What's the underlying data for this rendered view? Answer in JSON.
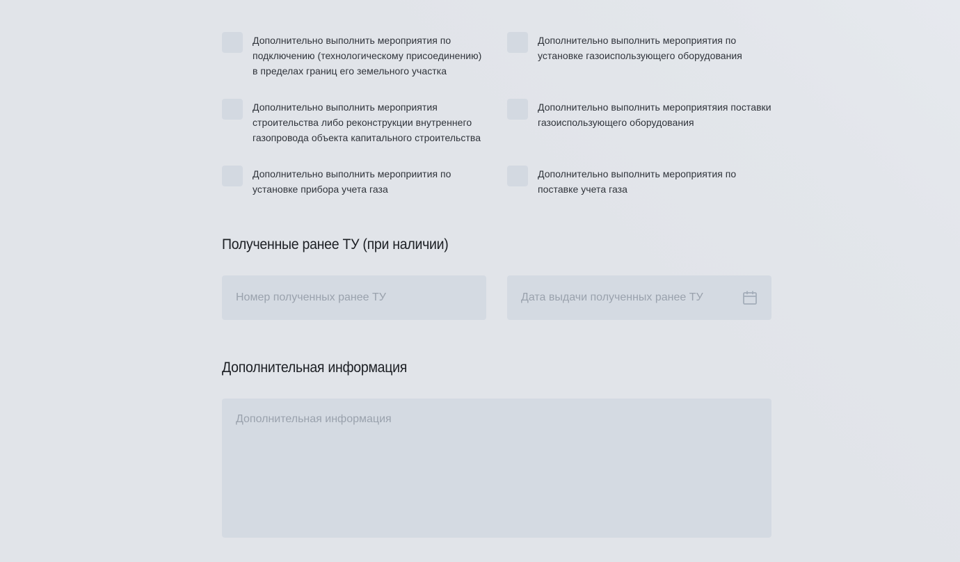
{
  "options": [
    {
      "label": "Дополнительно выполнить мероприятия по подключению (технологическому присоединению) в пределах границ его земельного участка",
      "checked": false
    },
    {
      "label": "Дополнительно выполнить мероприятия по установке газоиспользующего оборудования",
      "checked": false
    },
    {
      "label": "Дополнительно выполнить мероприятия строительства либо реконструкции внутреннего газопровода объекта капитального строительства",
      "checked": false
    },
    {
      "label": "Дополнительно выполнить мероприятяия поставки газоиспользующего оборудования",
      "checked": false
    },
    {
      "label": "Дополнительно выполнить мероприития по установке прибора учета газа",
      "checked": false
    },
    {
      "label": "Дополнительно выполнить мероприятия по поставке учета газа",
      "checked": false
    }
  ],
  "prior_tu": {
    "title": "Полученные ранее ТУ (при наличии)",
    "number_field": {
      "placeholder": "Номер полученных ранее ТУ",
      "value": ""
    },
    "date_field": {
      "placeholder": "Дата выдачи полученных ранее ТУ",
      "value": "",
      "icon": "calendar-icon"
    }
  },
  "additional_info": {
    "title": "Дополнительная информация",
    "textarea": {
      "placeholder": "Дополнительная информация",
      "value": ""
    }
  },
  "colors": {
    "background": "#e1e4e9",
    "field_background": "#d4dae2",
    "checkbox_background": "#d3d9e1",
    "placeholder": "#9aa2ad",
    "icon": "#a3adb9"
  }
}
